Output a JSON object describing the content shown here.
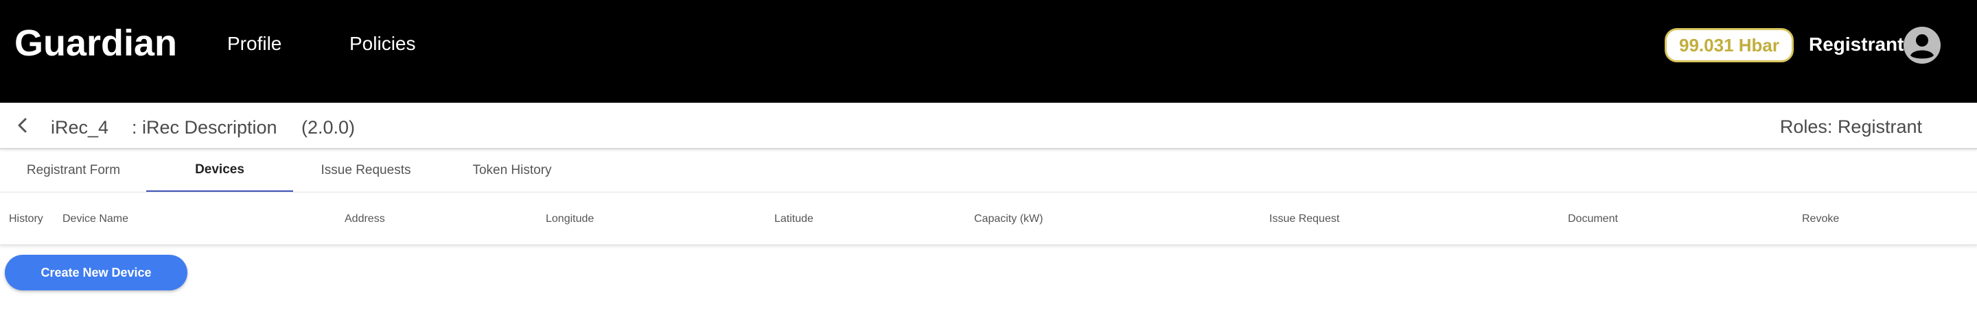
{
  "header": {
    "brand": "Guardian",
    "nav": [
      "Profile",
      "Policies"
    ],
    "balance": "99.031 Hbar",
    "user": "Registrant",
    "avatar_icon": "user-avatar-icon"
  },
  "policy": {
    "name": "iRec_4",
    "description": ": iRec Description",
    "version": "(2.0.0)",
    "roles": "Roles: Registrant"
  },
  "tabs": [
    {
      "label": "Registrant Form",
      "active": false
    },
    {
      "label": "Devices",
      "active": true
    },
    {
      "label": "Issue Requests",
      "active": false
    },
    {
      "label": "Token History",
      "active": false
    }
  ],
  "table": {
    "columns": [
      "History",
      "Device Name",
      "Address",
      "Longitude",
      "Latitude",
      "Capacity (kW)",
      "Issue Request",
      "Document",
      "Revoke"
    ]
  },
  "actions": {
    "create_device": "Create New Device"
  },
  "colors": {
    "header_bg": "#000000",
    "balance_border": "#d8c55d",
    "balance_text": "#c2ae3c",
    "tab_indicator": "#3f51b5",
    "primary_button": "#3f7cf0"
  }
}
